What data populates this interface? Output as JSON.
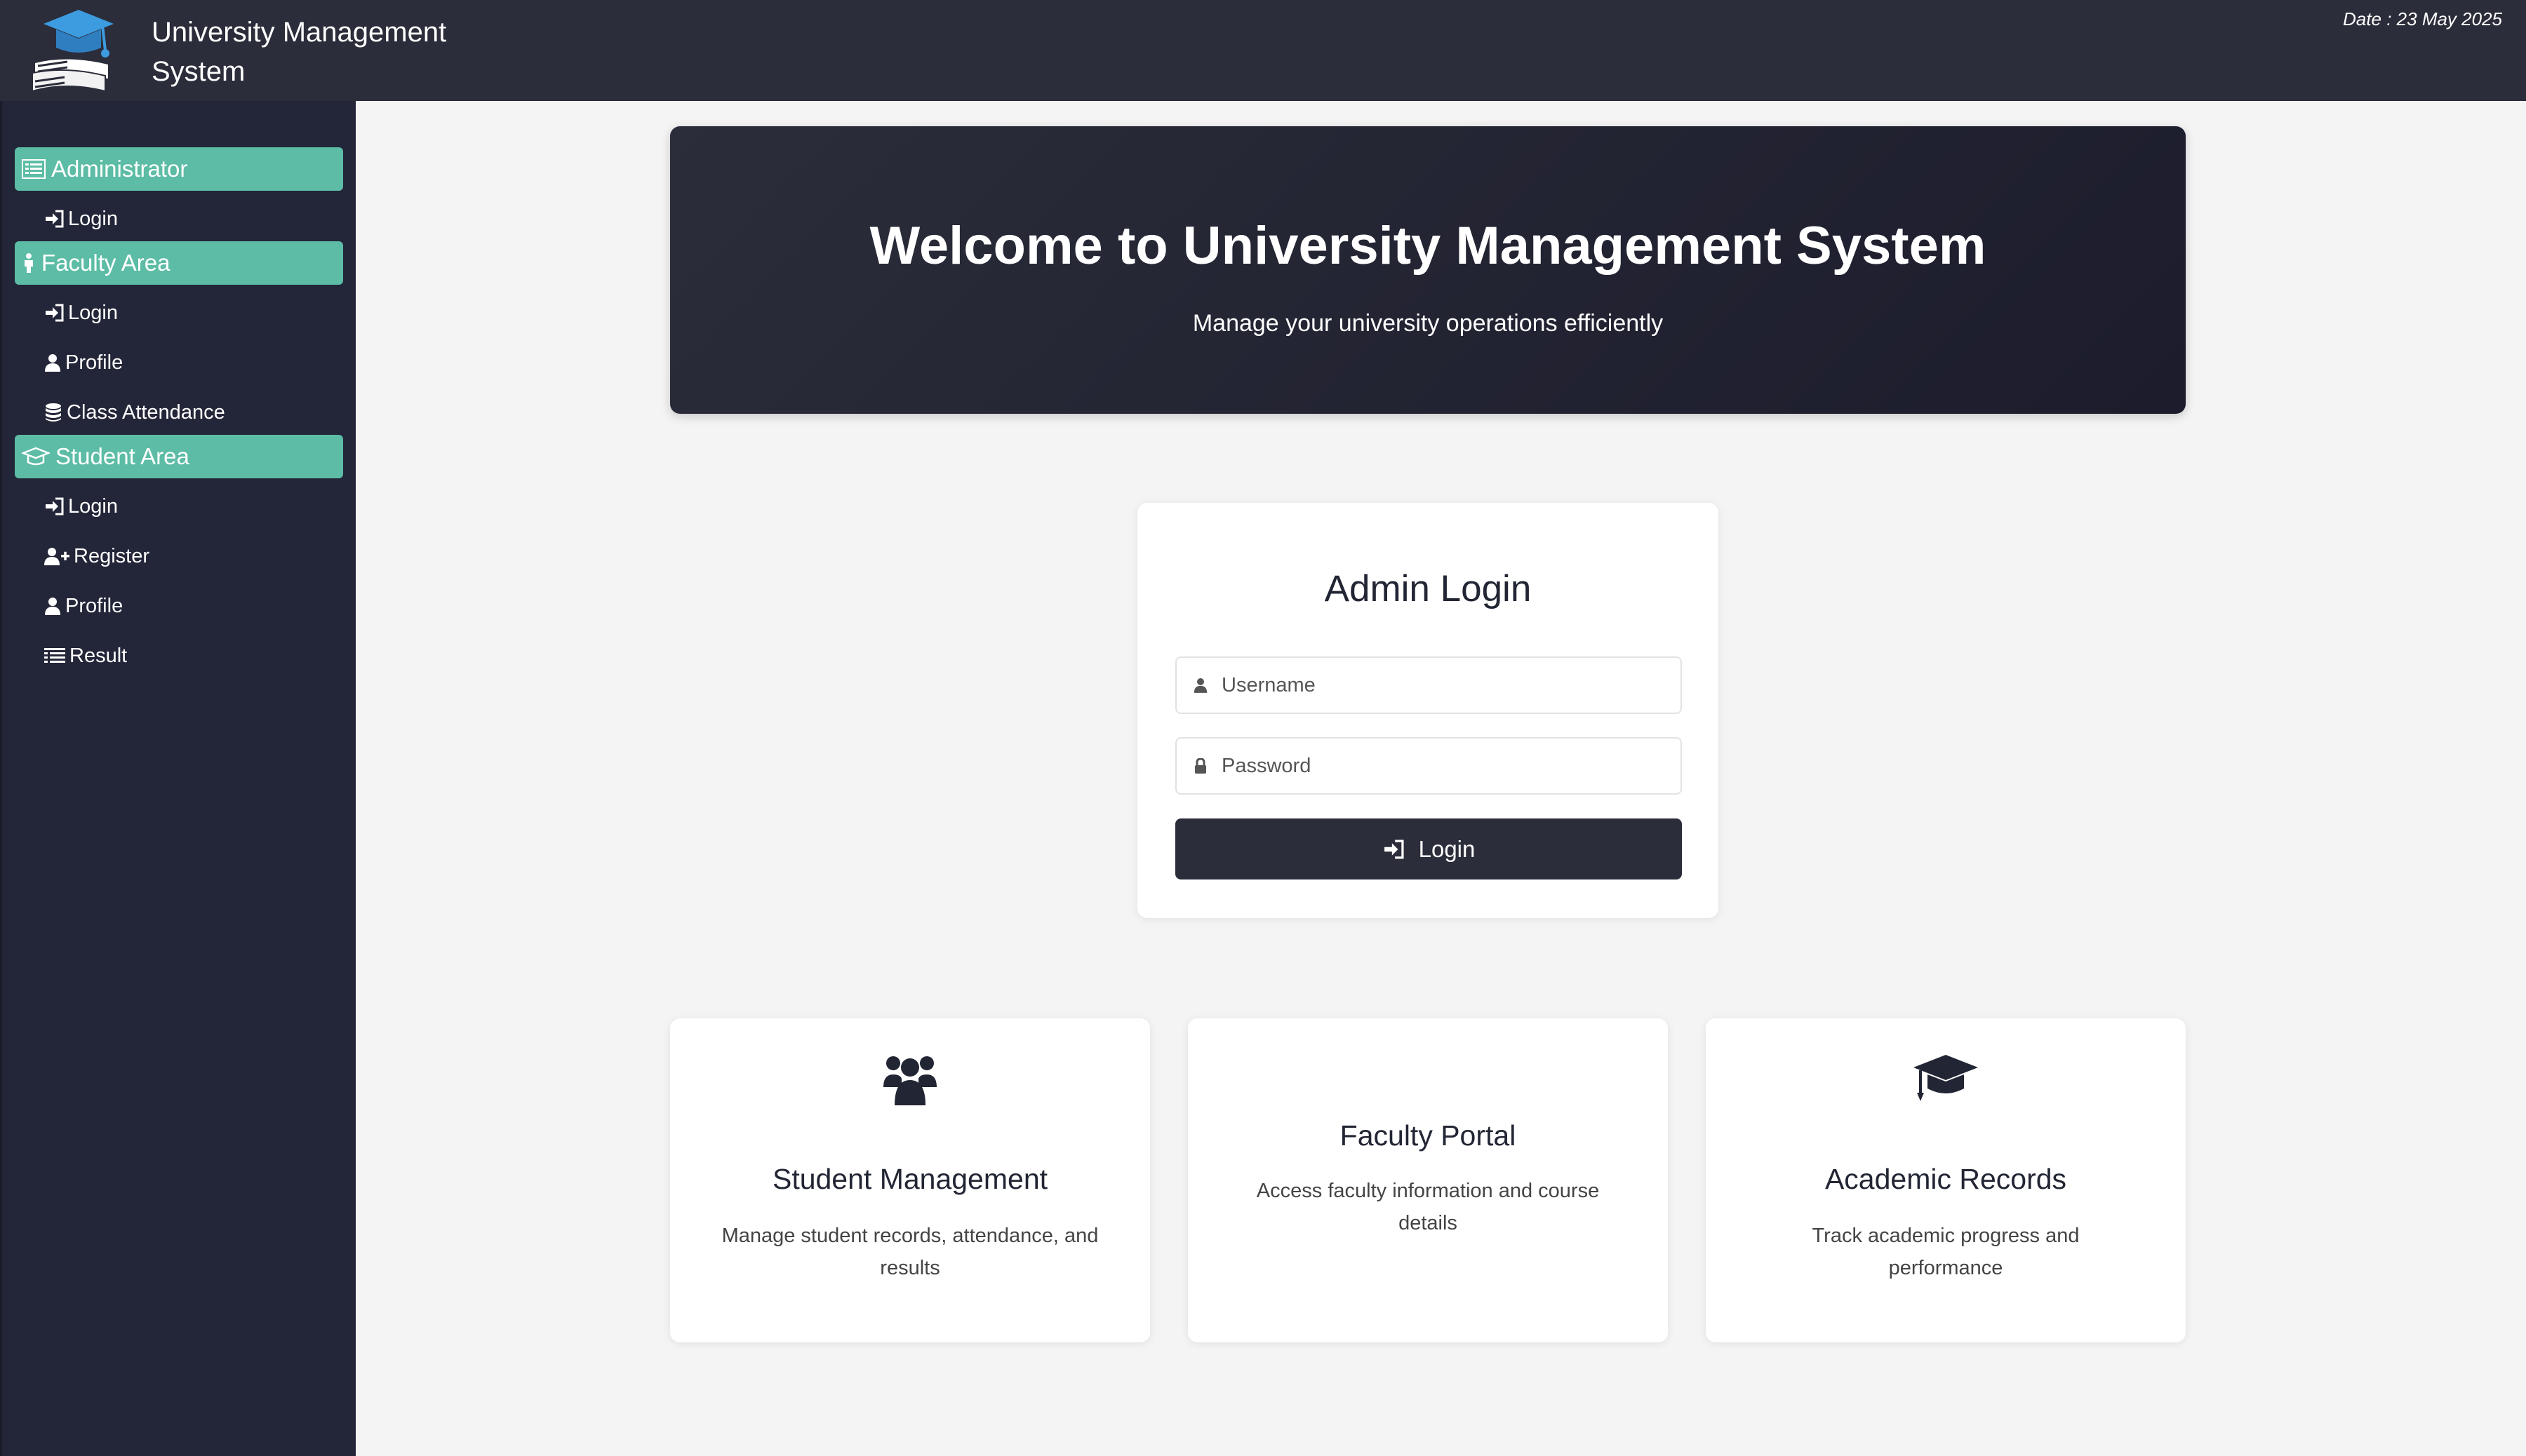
{
  "header": {
    "app_title": "University Management System",
    "date": "Date : 23 May 2025"
  },
  "sidebar": {
    "sections": [
      {
        "label": "Administrator",
        "icon": "list-icon",
        "items": [
          {
            "label": "Login",
            "icon": "sign-in-icon"
          }
        ]
      },
      {
        "label": "Faculty Area",
        "icon": "person-icon",
        "items": [
          {
            "label": "Login",
            "icon": "sign-in-icon"
          },
          {
            "label": "Profile",
            "icon": "user-icon"
          },
          {
            "label": "Class Attendance",
            "icon": "database-icon"
          }
        ]
      },
      {
        "label": "Student Area",
        "icon": "graduation-cap-icon",
        "items": [
          {
            "label": "Login",
            "icon": "sign-in-icon"
          },
          {
            "label": "Register",
            "icon": "user-plus-icon"
          },
          {
            "label": "Profile",
            "icon": "user-icon"
          },
          {
            "label": "Result",
            "icon": "list-icon"
          }
        ]
      }
    ]
  },
  "hero": {
    "title": "Welcome to University Management System",
    "subtitle": "Manage your university operations efficiently"
  },
  "login": {
    "title": "Admin Login",
    "username_placeholder": "Username",
    "password_placeholder": "Password",
    "button_label": "Login"
  },
  "features": [
    {
      "title": "Student Management",
      "description": "Manage student records, attendance, and results",
      "icon": "users-icon"
    },
    {
      "title": "Faculty Portal",
      "description": "Access faculty information and course details",
      "icon": ""
    },
    {
      "title": "Academic Records",
      "description": "Track academic progress and performance",
      "icon": "graduation-cap-icon"
    }
  ],
  "colors": {
    "header_bg": "#2b2d3a",
    "sidebar_bg": "#232538",
    "sidebar_section": "#5cbca5",
    "button_bg": "#2b2d3a",
    "page_bg": "#f4f4f4"
  }
}
